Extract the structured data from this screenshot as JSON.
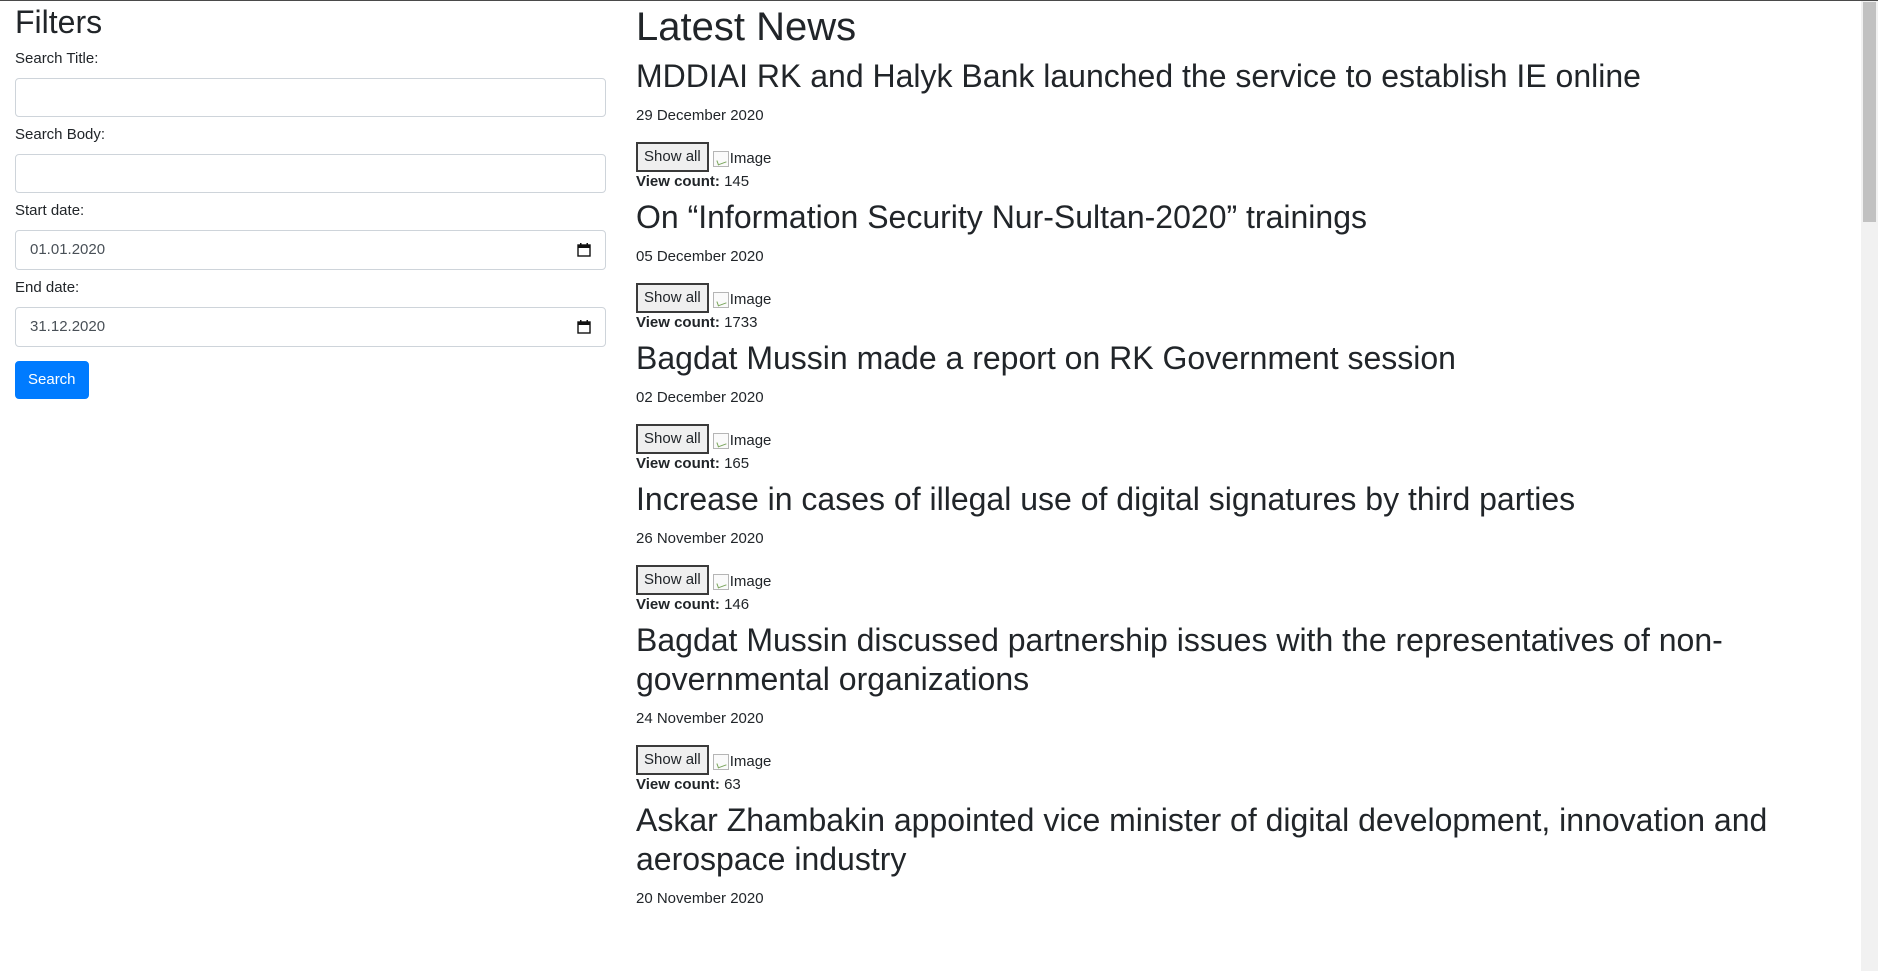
{
  "filters": {
    "title": "Filters",
    "search_title_label": "Search Title:",
    "search_title_value": "",
    "search_body_label": "Search Body:",
    "search_body_value": "",
    "start_date_label": "Start date:",
    "start_date_value": "01.01.2020",
    "end_date_label": "End date:",
    "end_date_value": "31.12.2020",
    "search_button": "Search"
  },
  "news": {
    "heading": "Latest News",
    "show_all_label": "Show all",
    "image_alt": "Image",
    "view_count_label": "View count:",
    "articles": [
      {
        "title": "MDDIAI RK and Halyk Bank launched the service to establish IE online",
        "date": "29 December 2020",
        "views": "145"
      },
      {
        "title": "On “Information Security Nur-Sultan-2020” trainings",
        "date": "05 December 2020",
        "views": "1733"
      },
      {
        "title": "Bagdat Mussin made a report on RK Government session",
        "date": "02 December 2020",
        "views": "165"
      },
      {
        "title": "Increase in cases of illegal use of digital signatures by third parties",
        "date": "26 November 2020",
        "views": "146"
      },
      {
        "title": "Bagdat Mussin discussed partnership issues with the representatives of non-governmental organizations",
        "date": "24 November 2020",
        "views": "63"
      },
      {
        "title": "Askar Zhambakin appointed vice minister of digital development, innovation and aerospace industry",
        "date": "20 November 2020",
        "views": ""
      }
    ]
  },
  "colors": {
    "primary": "#007bff",
    "text": "#212529",
    "border": "#ced4da"
  }
}
